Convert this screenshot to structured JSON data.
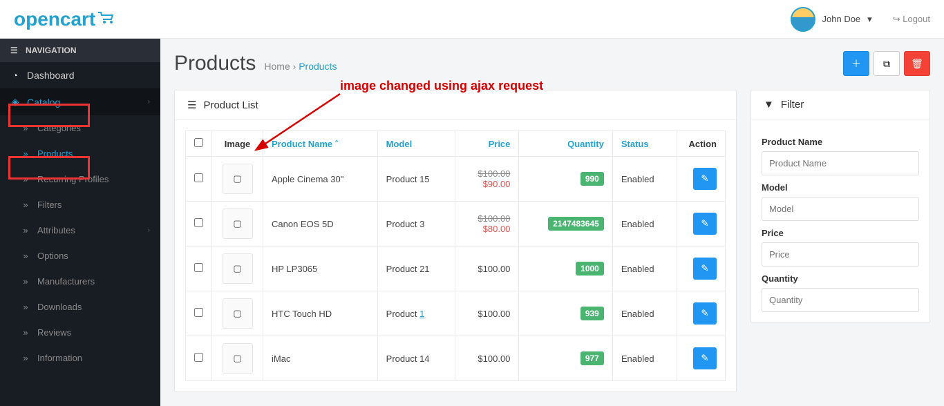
{
  "header": {
    "logo": "opencart",
    "user_name": "John Doe",
    "logout": "Logout"
  },
  "nav": {
    "title": "NAVIGATION",
    "dashboard": "Dashboard",
    "catalog": "Catalog",
    "sub": {
      "categories": "Categories",
      "products": "Products",
      "recurring": "Recurring Profiles",
      "filters": "Filters",
      "attributes": "Attributes",
      "options": "Options",
      "manufacturers": "Manufacturers",
      "downloads": "Downloads",
      "reviews": "Reviews",
      "information": "Information"
    }
  },
  "page": {
    "title": "Products",
    "breadcrumb_home": "Home",
    "breadcrumb_sep": "›",
    "breadcrumb_current": "Products"
  },
  "annotation": "image changed using ajax request",
  "list": {
    "title": "Product List",
    "cols": {
      "image": "Image",
      "name": "Product Name",
      "model": "Model",
      "price": "Price",
      "qty": "Quantity",
      "status": "Status",
      "action": "Action"
    },
    "rows": [
      {
        "name": "Apple Cinema 30\"",
        "model": "Product 15",
        "price_old": "$100.00",
        "price_new": "$90.00",
        "qty": "990",
        "status": "Enabled"
      },
      {
        "name": "Canon EOS 5D",
        "model": "Product 3",
        "price_old": "$100.00",
        "price_new": "$80.00",
        "qty": "2147483645",
        "status": "Enabled"
      },
      {
        "name": "HP LP3065",
        "model": "Product 21",
        "price": "$100.00",
        "qty": "1000",
        "status": "Enabled"
      },
      {
        "name": "HTC Touch HD",
        "model_pre": "Product ",
        "model_link": "1",
        "price": "$100.00",
        "qty": "939",
        "status": "Enabled"
      },
      {
        "name": "iMac",
        "model": "Product 14",
        "price": "$100.00",
        "qty": "977",
        "status": "Enabled"
      }
    ]
  },
  "filter": {
    "title": "Filter",
    "name_label": "Product Name",
    "name_ph": "Product Name",
    "model_label": "Model",
    "model_ph": "Model",
    "price_label": "Price",
    "price_ph": "Price",
    "qty_label": "Quantity",
    "qty_ph": "Quantity"
  }
}
